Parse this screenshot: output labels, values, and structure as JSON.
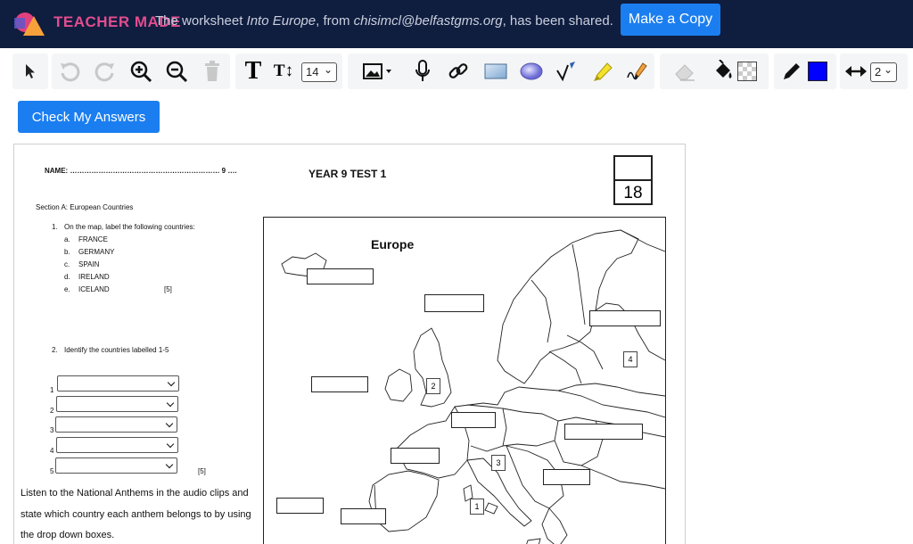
{
  "banner": {
    "logo_text": "TEACHER MADE",
    "msg_prefix": "The worksheet ",
    "worksheet_name": "Into Europe",
    "msg_middle": ", from ",
    "author": "chisimcl@belfastgms.org",
    "msg_suffix": ", has been shared.",
    "copy_button": "Make a Copy"
  },
  "toolbar": {
    "font_size": "14",
    "line_width": "2",
    "fill_color": "#ffffff",
    "pen_color": "#0000ff",
    "text_tool": "T",
    "text_size_tool": "T↕"
  },
  "check_button": "Check My Answers",
  "worksheet": {
    "name_line": "NAME: ………………………………………………………    9 ….",
    "title": "YEAR 9 TEST 1",
    "score_total": "18",
    "section": "Section A: European Countries",
    "q1_num": "1.",
    "q1": "On the map, label the following countries:",
    "q1_items": [
      {
        "letter": "a.",
        "text": "FRANCE"
      },
      {
        "letter": "b.",
        "text": "GERMANY"
      },
      {
        "letter": "c.",
        "text": "SPAIN"
      },
      {
        "letter": "d.",
        "text": "IRELAND"
      },
      {
        "letter": "e.",
        "text": "ICELAND"
      }
    ],
    "q1_marks": "[5]",
    "q2_num": "2.",
    "q2": "Identify the countries labelled 1-5",
    "q2_rows": [
      "1",
      "2",
      "3",
      "4",
      "5"
    ],
    "q2_marks": "[5]",
    "anthem_line1": "Listen to the National Anthems in the audio clips and",
    "anthem_line2": "state which country each anthem belongs to by using",
    "anthem_line3": "the drop down boxes.",
    "map_title": "Europe",
    "map_numbers": [
      "1",
      "2",
      "3",
      "4"
    ]
  }
}
